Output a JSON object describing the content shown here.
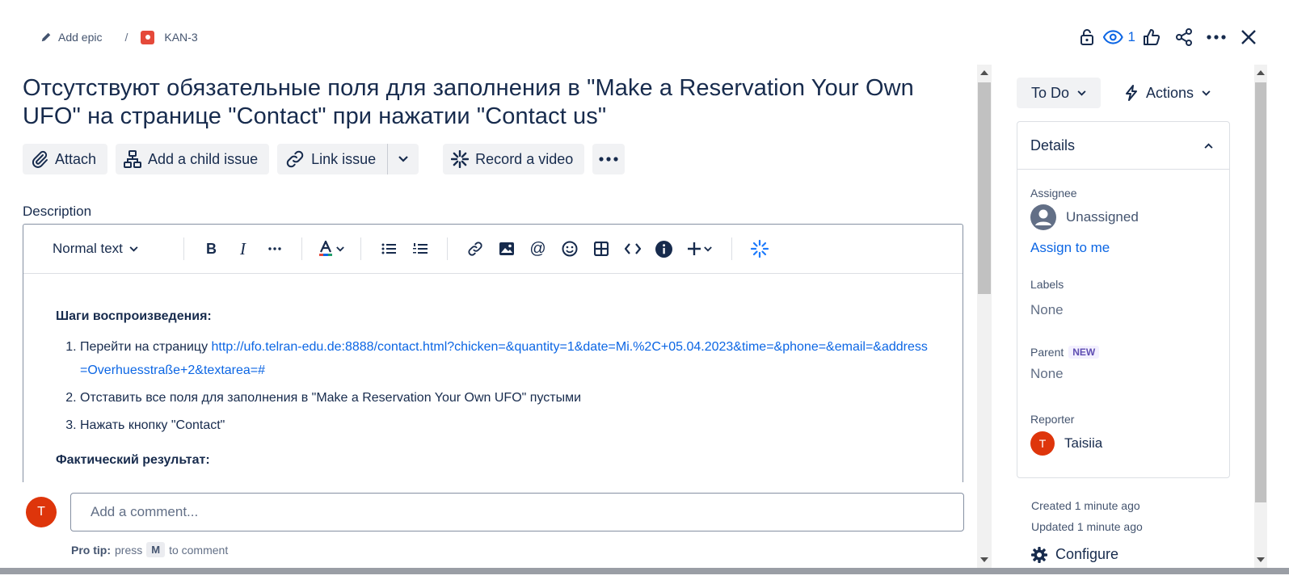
{
  "breadcrumb": {
    "add_epic": "Add epic",
    "separator": "/",
    "issue_key": "KAN-3"
  },
  "header": {
    "watchers_count": "1"
  },
  "issue": {
    "title": "Отсутствуют обязательные поля для заполнения в \"Make a Reservation Your Own UFO\" на странице \"Contact\" при нажатии \"Contact us\""
  },
  "toolbar": {
    "attach": "Attach",
    "add_child": "Add a child issue",
    "link_issue": "Link issue",
    "record_video": "Record a video"
  },
  "description": {
    "label": "Description",
    "text_style": "Normal text",
    "steps_heading": "Шаги воспроизведения:",
    "step1_prefix": "Перейти на страницу ",
    "step1_link": "http://ufo.telran-edu.de:8888/contact.html?chicken=&quantity=1&date=Mi.%2C+05.04.2023&time=&phone=&email=&address=Overhuesstraße+2&textarea=#",
    "step2": "Отставить все поля для заполнения в \"Make a Reservation Your Own UFO\" пустыми",
    "step3": "Нажать кнопку \"Contact\"",
    "actual_heading": "Фактический результат:"
  },
  "comment": {
    "avatar_initial": "T",
    "placeholder": "Add a comment...",
    "protip_label": "Pro tip:",
    "protip_press": "press",
    "protip_key": "M",
    "protip_suffix": "to comment"
  },
  "sidebar": {
    "status": "To Do",
    "actions": "Actions",
    "details_title": "Details",
    "assignee_label": "Assignee",
    "assignee_value": "Unassigned",
    "assign_to_me": "Assign to me",
    "labels_label": "Labels",
    "labels_value": "None",
    "parent_label": "Parent",
    "parent_badge": "NEW",
    "parent_value": "None",
    "reporter_label": "Reporter",
    "reporter_initial": "T",
    "reporter_name": "Taisiia",
    "created": "Created 1 minute ago",
    "updated": "Updated 1 minute ago",
    "configure": "Configure"
  },
  "colors": {
    "accent": "#0c66e4",
    "avatar": "#de350b",
    "text": "#172b4d",
    "button_bg": "#f1f2f4"
  }
}
